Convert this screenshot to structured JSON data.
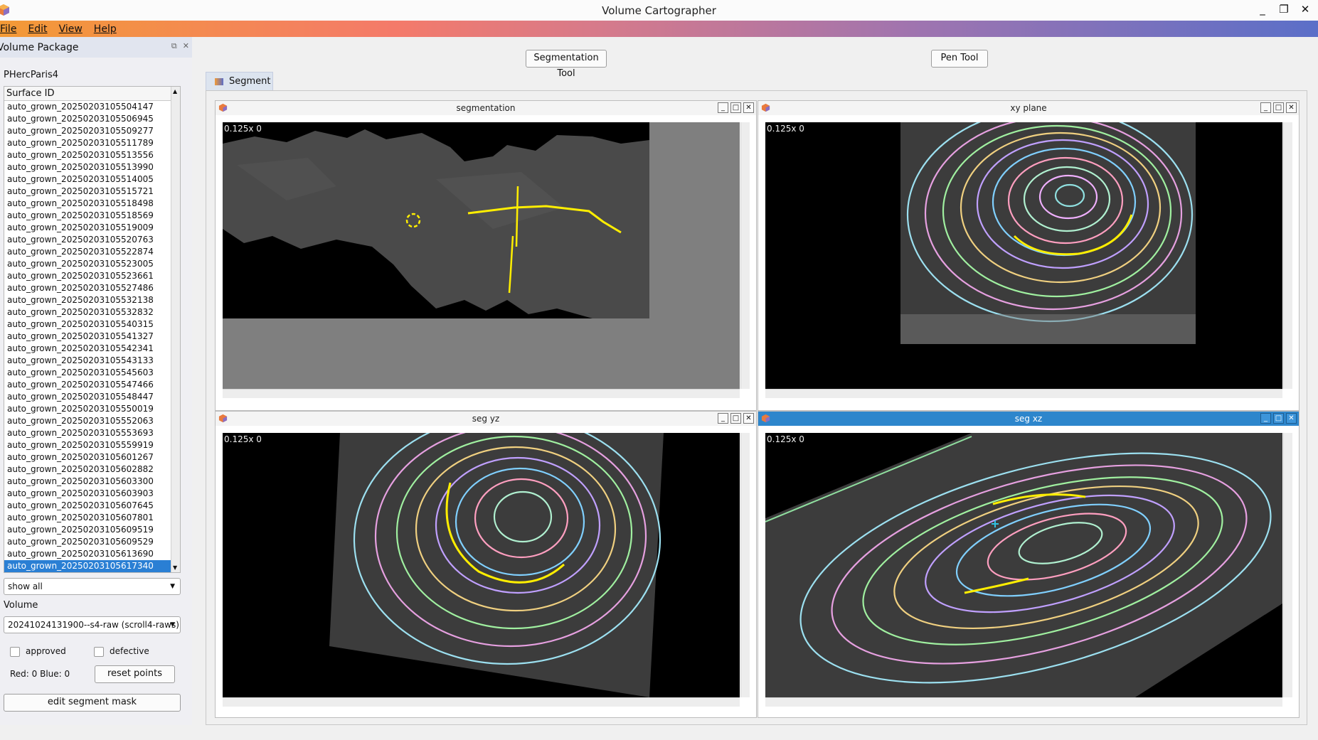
{
  "app": {
    "title": "Volume Cartographer"
  },
  "window_controls": {
    "minimize": "_",
    "restore": "❐",
    "close": "✕"
  },
  "menu": {
    "file": "File",
    "edit": "Edit",
    "view": "View",
    "help": "Help"
  },
  "dock": {
    "title": "Volume Package",
    "package": "PHercParis4",
    "list_header": "Surface ID",
    "surfaces": [
      "auto_grown_20250203105504147",
      "auto_grown_20250203105506945",
      "auto_grown_20250203105509277",
      "auto_grown_20250203105511789",
      "auto_grown_20250203105513556",
      "auto_grown_20250203105513990",
      "auto_grown_20250203105514005",
      "auto_grown_20250203105515721",
      "auto_grown_20250203105518498",
      "auto_grown_20250203105518569",
      "auto_grown_20250203105519009",
      "auto_grown_20250203105520763",
      "auto_grown_20250203105522874",
      "auto_grown_20250203105523005",
      "auto_grown_20250203105523661",
      "auto_grown_20250203105527486",
      "auto_grown_20250203105532138",
      "auto_grown_20250203105532832",
      "auto_grown_20250203105540315",
      "auto_grown_20250203105541327",
      "auto_grown_20250203105542341",
      "auto_grown_20250203105543133",
      "auto_grown_20250203105545603",
      "auto_grown_20250203105547466",
      "auto_grown_20250203105548447",
      "auto_grown_20250203105550019",
      "auto_grown_20250203105552063",
      "auto_grown_20250203105553693",
      "auto_grown_20250203105559919",
      "auto_grown_20250203105601267",
      "auto_grown_20250203105602882",
      "auto_grown_20250203105603300",
      "auto_grown_20250203105603903",
      "auto_grown_20250203105607645",
      "auto_grown_20250203105607801",
      "auto_grown_20250203105609519",
      "auto_grown_20250203105609529",
      "auto_grown_20250203105613690",
      "auto_grown_20250203105617340"
    ],
    "selected": "auto_grown_20250203105617340",
    "filter": "show all",
    "volume_label": "Volume",
    "volume": "20241024131900--s4-raw (scroll4-raws)",
    "approved": "approved",
    "defective": "defective",
    "points": "Red: 0 Blue: 0",
    "reset": "reset points",
    "edit_mask": "edit segment mask"
  },
  "toolbar": {
    "seg_tool": "Segmentation Tool",
    "pen_tool": "Pen Tool"
  },
  "tab": {
    "label": "Segment"
  },
  "views": {
    "segmentation": "segmentation",
    "xy": "xy plane",
    "segyz": "seg yz",
    "segxz": "seg xz",
    "zoom": "0.125x 0"
  },
  "colors": {
    "accent": "#2d86cc",
    "highlight": "#ffee00"
  }
}
